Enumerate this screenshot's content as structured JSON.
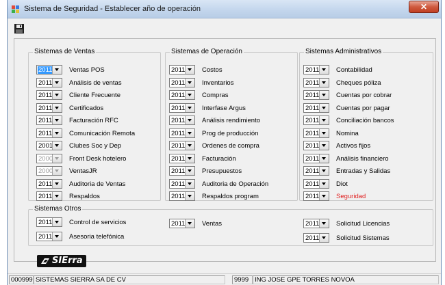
{
  "window": {
    "title": "Sistema de Seguridad - Establecer año de operación",
    "close_glyph": "✕"
  },
  "toolbar": {
    "save_icon": "floppy-disk-icon"
  },
  "groups": {
    "ventas": {
      "title": "Sistemas de Ventas",
      "items": [
        {
          "year": "2011",
          "label": "Ventas POS",
          "state": "selected"
        },
        {
          "year": "2011",
          "label": "Análisis de ventas",
          "state": "normal"
        },
        {
          "year": "2011",
          "label": "Cliente Frecuente",
          "state": "normal"
        },
        {
          "year": "2011",
          "label": "Certificados",
          "state": "normal"
        },
        {
          "year": "2011",
          "label": "Facturación RFC",
          "state": "normal"
        },
        {
          "year": "2011",
          "label": "Comunicación Remota",
          "state": "normal"
        },
        {
          "year": "2001",
          "label": "Clubes Soc y Dep",
          "state": "normal"
        },
        {
          "year": "2000",
          "label": "Front Desk hotelero",
          "state": "disabled"
        },
        {
          "year": "2000",
          "label": "VentasJR",
          "state": "disabled"
        },
        {
          "year": "2011",
          "label": "Auditoria de Ventas",
          "state": "normal"
        },
        {
          "year": "2011",
          "label": "Respaldos",
          "state": "normal"
        }
      ]
    },
    "operacion": {
      "title": "Sistemas de Operación",
      "items": [
        {
          "year": "2011",
          "label": "Costos",
          "state": "normal"
        },
        {
          "year": "2011",
          "label": "Inventarios",
          "state": "normal"
        },
        {
          "year": "2011",
          "label": "Compras",
          "state": "normal"
        },
        {
          "year": "2011",
          "label": "Interfase Argus",
          "state": "normal"
        },
        {
          "year": "2011",
          "label": "Análisis rendimiento",
          "state": "normal"
        },
        {
          "year": "2011",
          "label": "Prog de producción",
          "state": "normal"
        },
        {
          "year": "2011",
          "label": "Ordenes de compra",
          "state": "normal"
        },
        {
          "year": "2011",
          "label": "Facturación",
          "state": "normal"
        },
        {
          "year": "2011",
          "label": "Presupuestos",
          "state": "normal"
        },
        {
          "year": "2011",
          "label": "Auditoria de Operación",
          "state": "normal"
        },
        {
          "year": "2011",
          "label": "Respaldos program",
          "state": "normal"
        }
      ]
    },
    "administrativos": {
      "title": "Sistemas Administrativos",
      "items": [
        {
          "year": "2011",
          "label": "Contabilidad",
          "state": "normal"
        },
        {
          "year": "2011",
          "label": "Cheques póliza",
          "state": "normal"
        },
        {
          "year": "2011",
          "label": "Cuentas por cobrar",
          "state": "normal"
        },
        {
          "year": "2011",
          "label": "Cuentas por pagar",
          "state": "normal"
        },
        {
          "year": "2011",
          "label": "Conciliación bancos",
          "state": "normal"
        },
        {
          "year": "2011",
          "label": "Nomina",
          "state": "normal"
        },
        {
          "year": "2011",
          "label": "Activos fijos",
          "state": "normal"
        },
        {
          "year": "2011",
          "label": "Análisis financiero",
          "state": "normal"
        },
        {
          "year": "2011",
          "label": "Entradas y Salidas",
          "state": "normal"
        },
        {
          "year": "2011",
          "label": "Diot",
          "state": "normal"
        },
        {
          "year": "2011",
          "label": "Seguridad",
          "state": "highlight"
        }
      ]
    },
    "otros": {
      "title": "Sistemas Otros",
      "items": [
        {
          "year": "2011",
          "label": "Control de servicios",
          "state": "normal"
        },
        {
          "year": "2011",
          "label": "Asesoria telefónica",
          "state": "normal"
        },
        {
          "year": "2011",
          "label": "Ventas",
          "state": "normal"
        },
        {
          "year": "2011",
          "label": "Solicitud Licencias",
          "state": "normal"
        },
        {
          "year": "2011",
          "label": "Solicitud Sistemas",
          "state": "normal"
        }
      ]
    }
  },
  "logo": {
    "text": "SIErra"
  },
  "status": {
    "company_code": "000999",
    "company_name": "SISTEMAS SIERRA SA DE CV",
    "user_code": "9999",
    "user_name": "ING JOSE GPE TORRES NOVOA"
  },
  "colors": {
    "selected_bg": "#3399ff",
    "highlight_text": "#e02020",
    "close_button": "#c94a2f"
  }
}
